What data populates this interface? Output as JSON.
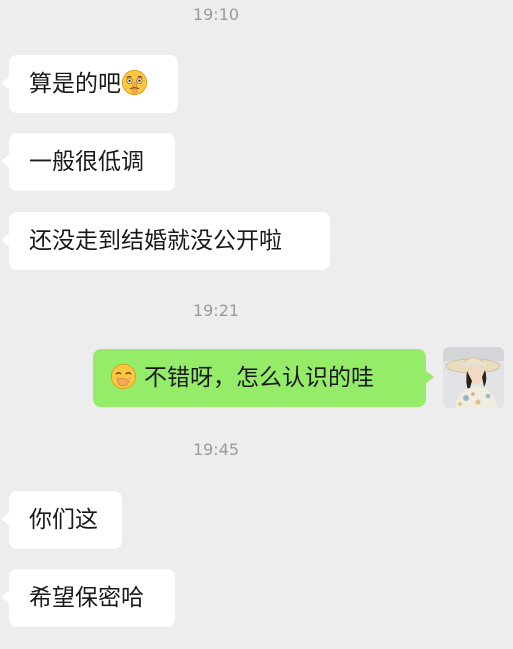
{
  "chat": {
    "timestamps": [
      "19:10",
      "19:21",
      "19:45"
    ],
    "messages": [
      {
        "text": "算是的吧",
        "emoji": "shushing-face-emoji"
      },
      {
        "text": "一般很低调"
      },
      {
        "text": "还没走到结婚就没公开啦"
      },
      {
        "text": "不错呀，怎么认识的哇",
        "emoji": "hand-over-mouth-emoji"
      },
      {
        "text": "你们这"
      },
      {
        "text": "希望保密哈"
      }
    ]
  },
  "colors": {
    "background": "#ededed",
    "incoming_bubble": "#ffffff",
    "outgoing_bubble": "#95ec69",
    "timestamp_text": "#9a9a9a",
    "message_text": "#191919"
  }
}
